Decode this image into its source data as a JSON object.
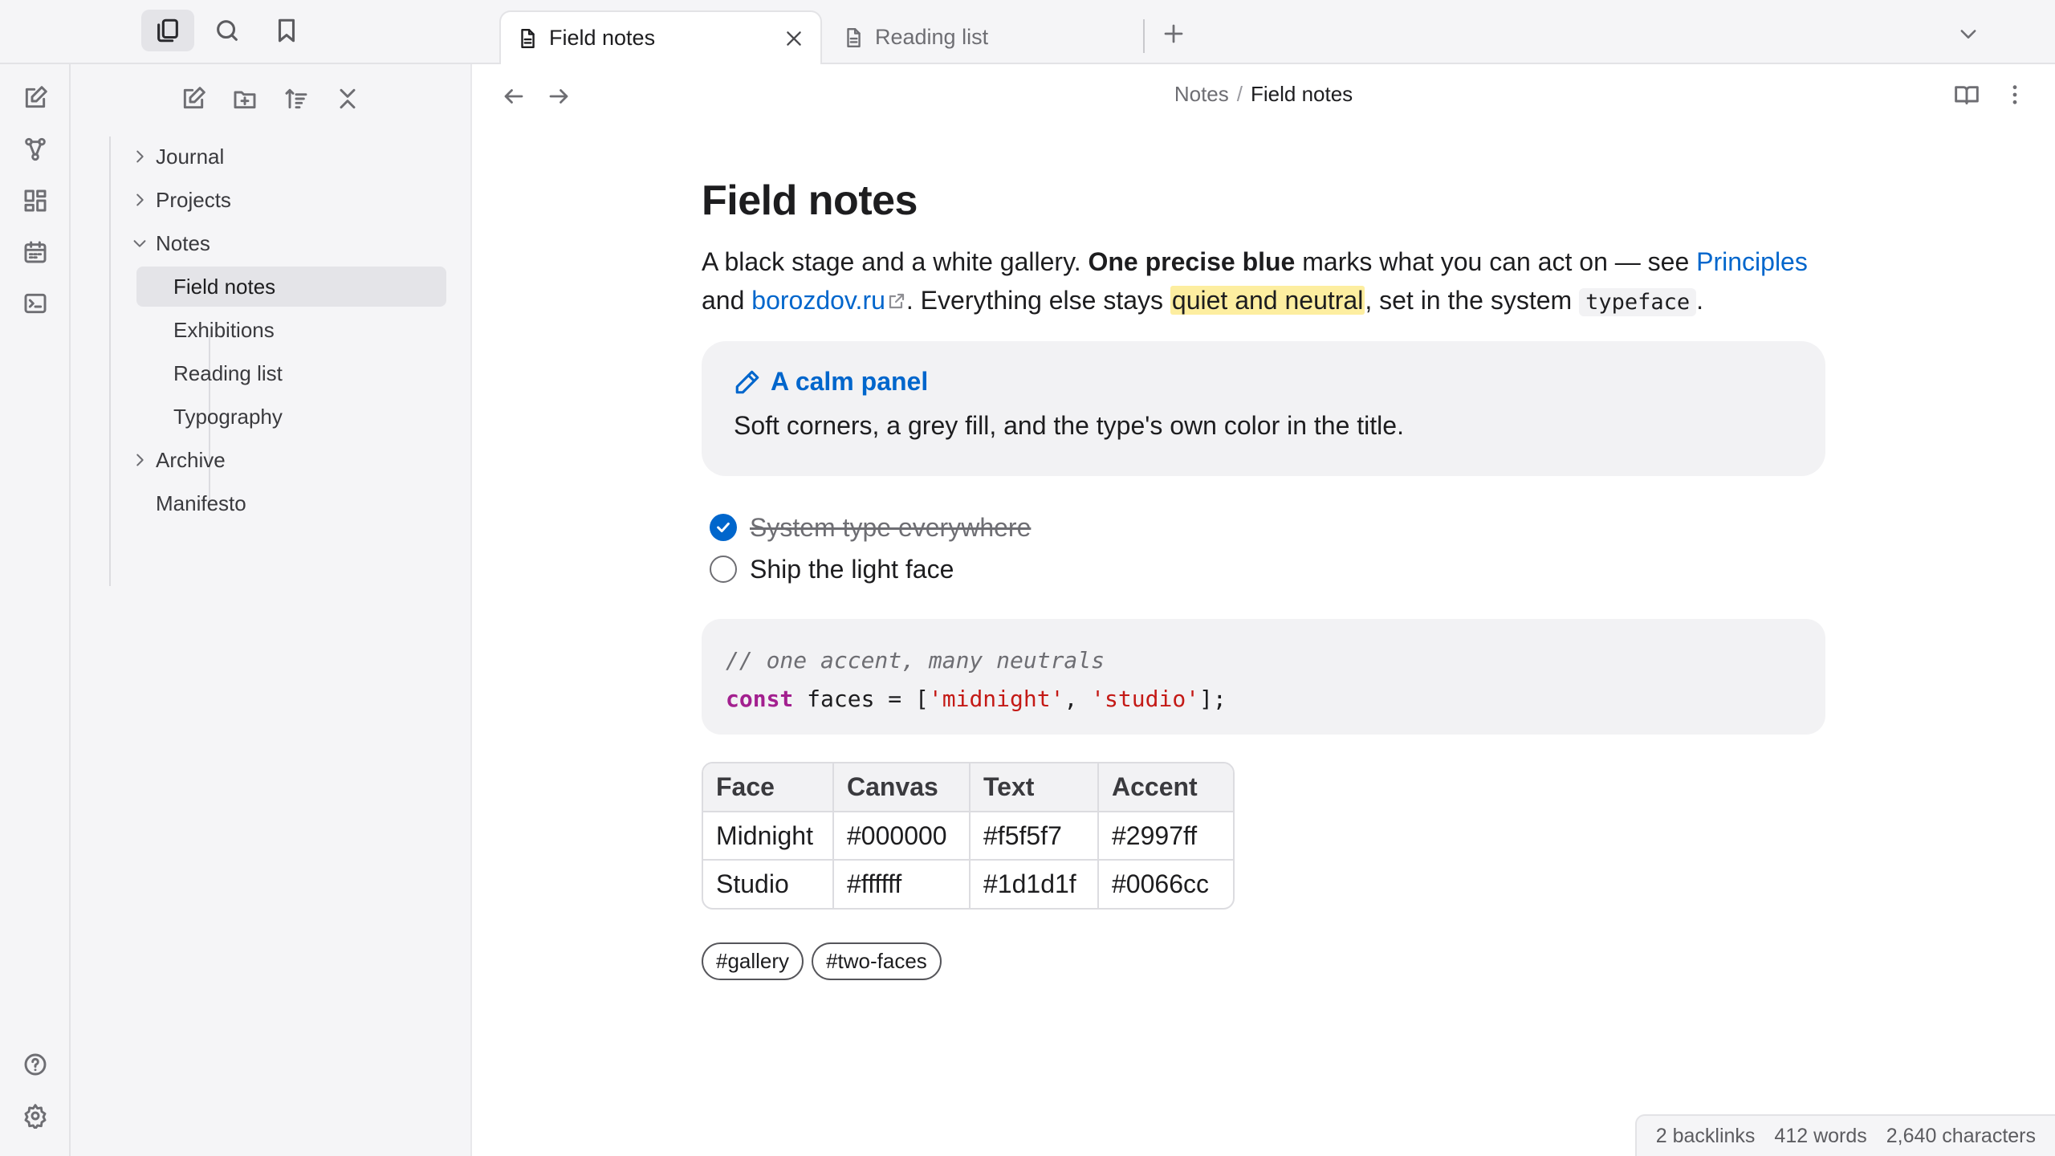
{
  "tabs": [
    {
      "label": "Field notes",
      "active": true
    },
    {
      "label": "Reading list",
      "active": false
    }
  ],
  "sidebar": {
    "tree": [
      {
        "label": "Journal",
        "type": "folder",
        "expanded": false
      },
      {
        "label": "Projects",
        "type": "folder",
        "expanded": false
      },
      {
        "label": "Notes",
        "type": "folder",
        "expanded": true,
        "children": [
          {
            "label": "Field notes",
            "selected": true
          },
          {
            "label": "Exhibitions"
          },
          {
            "label": "Reading list"
          },
          {
            "label": "Typography"
          }
        ]
      },
      {
        "label": "Archive",
        "type": "folder",
        "expanded": false
      },
      {
        "label": "Manifesto",
        "type": "file"
      }
    ]
  },
  "breadcrumb": {
    "parent": "Notes",
    "separator": "/",
    "current": "Field notes"
  },
  "doc": {
    "title": "Field notes",
    "p1": {
      "t1": "A black stage and a white gallery. ",
      "bold": "One precise blue",
      "t2": " marks what you can act on — see ",
      "link1": "Principles",
      "t3": " and ",
      "link2": "borozdov.ru",
      "t4": ". Everything else stays ",
      "highlight": "quiet and neutral",
      "t5": ", set in the system ",
      "code": "typeface",
      "t6": "."
    },
    "callout": {
      "title": "A calm panel",
      "body": "Soft corners, a grey fill, and the type's own color in the title."
    },
    "tasks": [
      {
        "label": "System type everywhere",
        "done": true
      },
      {
        "label": "Ship the light face",
        "done": false
      }
    ],
    "code": {
      "comment": "// one accent, many neutrals",
      "kw": "const",
      "ident": " faces = [",
      "str1": "'midnight'",
      "comma": ", ",
      "str2": "'studio'",
      "end": "];"
    },
    "table": {
      "headers": [
        "Face",
        "Canvas",
        "Text",
        "Accent"
      ],
      "rows": [
        [
          "Midnight",
          "#000000",
          "#f5f5f7",
          "#2997ff"
        ],
        [
          "Studio",
          "#ffffff",
          "#1d1d1f",
          "#0066cc"
        ]
      ]
    },
    "tags": [
      "#gallery",
      "#two-faces"
    ]
  },
  "status": {
    "backlinks": "2 backlinks",
    "words": "412 words",
    "chars": "2,640 characters"
  },
  "colors": {
    "accent": "#0066cc",
    "highlight": "#fdeea0",
    "chrome": "#f5f5f7",
    "code_keyword": "#a3208f",
    "code_string": "#c41a16"
  }
}
